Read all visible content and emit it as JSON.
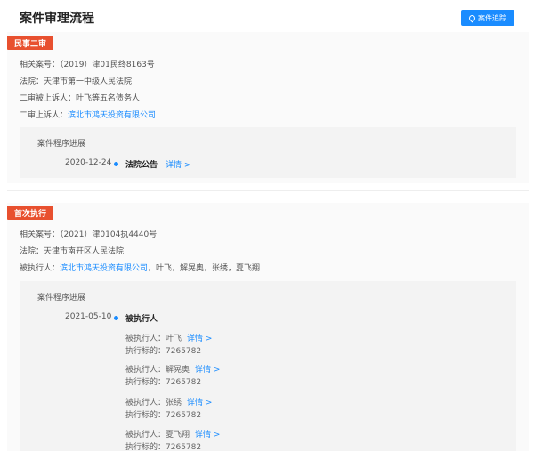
{
  "header": {
    "title": "案件审理流程",
    "export_button": "案件追踪"
  },
  "case1": {
    "tag": "民事二审",
    "case_no_label": "相关案号：",
    "case_no": "（2019）津01民终8163号",
    "court_label": "法院：",
    "court": "天津市第一中级人民法院",
    "appellant_label": "二审被上诉人：",
    "appellant": "叶飞等五名债务人",
    "appellee_label": "二审上诉人：",
    "appellee": "滨北市鸿天投资有限公司",
    "progress_title": "案件程序进展",
    "date": "2020-12-24",
    "event": "法院公告",
    "detail": "详情 >"
  },
  "case2": {
    "tag": "首次执行",
    "case_no_label": "相关案号：",
    "case_no": "（2021）津0104执4440号",
    "court_label": "法院：",
    "court": "天津市南开区人民法院",
    "executed_label": "被执行人：",
    "executed_company": "滨北市鸿天投资有限公司",
    "executed_others": "，叶飞，解晃奥，张绣，夏飞翔",
    "progress_title": "案件程序进展",
    "date": "2021-05-10",
    "event": "被执行人",
    "items": [
      {
        "person_label": "被执行人：",
        "person": "叶飞",
        "detail": "详情 >",
        "amount_label": "执行标的：",
        "amount": "7265782"
      },
      {
        "person_label": "被执行人：",
        "person": "解晃奥",
        "detail": "详情 >",
        "amount_label": "执行标的：",
        "amount": "7265782"
      },
      {
        "person_label": "被执行人：",
        "person": "张绣",
        "detail": "详情 >",
        "amount_label": "执行标的：",
        "amount": "7265782"
      },
      {
        "person_label": "被执行人：",
        "person": "夏飞翔",
        "detail": "详情 >",
        "amount_label": "执行标的：",
        "amount": "7265782"
      }
    ]
  }
}
